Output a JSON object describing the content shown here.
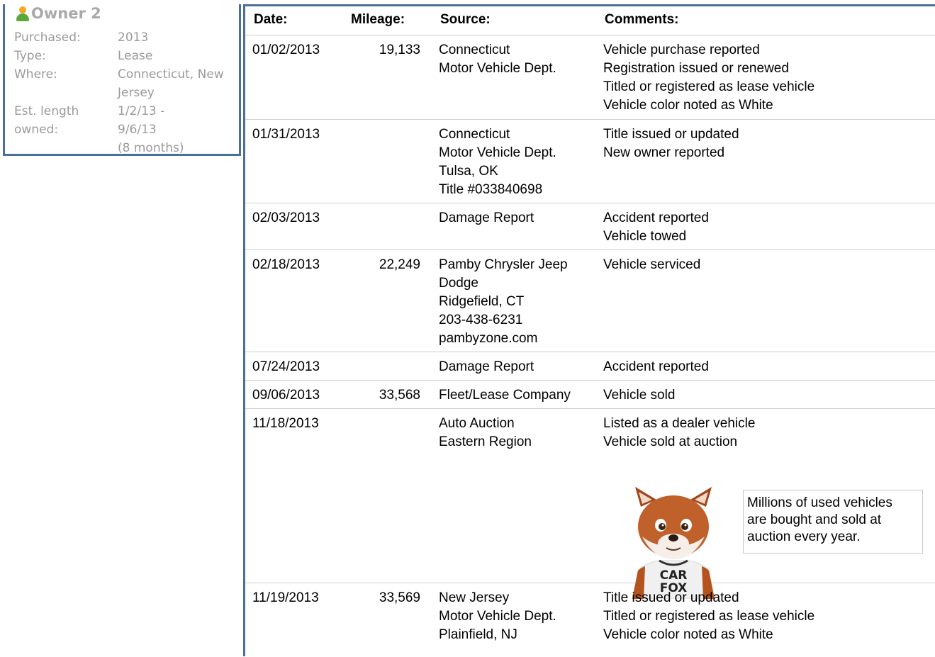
{
  "owner": {
    "title": "Owner 2",
    "fields": [
      {
        "label": "Purchased:",
        "value": [
          "2013"
        ]
      },
      {
        "label": "Type:",
        "value": [
          "Lease"
        ]
      },
      {
        "label": "Where:",
        "value": [
          "Connecticut, New",
          "Jersey"
        ]
      },
      {
        "label": "Est. length",
        "value": [
          "1/2/13 -"
        ]
      },
      {
        "label": "owned:",
        "value": [
          "9/6/13",
          "(8 months)"
        ]
      }
    ]
  },
  "table": {
    "headers": {
      "date": "Date:",
      "mileage": "Mileage:",
      "source": "Source:",
      "comments": "Comments:"
    },
    "rows": [
      {
        "date": "01/02/2013",
        "mileage": "19,133",
        "source": [
          "Connecticut",
          "Motor Vehicle Dept."
        ],
        "comments": [
          "Vehicle purchase reported",
          "Registration issued or renewed",
          "Titled or registered as lease vehicle",
          "Vehicle color noted as White"
        ]
      },
      {
        "date": "01/31/2013",
        "mileage": "",
        "source": [
          "Connecticut",
          "Motor Vehicle Dept.",
          "Tulsa, OK",
          "Title #033840698"
        ],
        "comments": [
          "Title issued or updated",
          "New owner reported"
        ]
      },
      {
        "date": "02/03/2013",
        "mileage": "",
        "source": [
          "Damage Report"
        ],
        "comments": [
          "Accident reported",
          "Vehicle towed"
        ]
      },
      {
        "date": "02/18/2013",
        "mileage": "22,249",
        "source": [
          "Pamby Chrysler Jeep",
          "Dodge",
          "Ridgefield, CT",
          "203-438-6231",
          "pambyzone.com"
        ],
        "comments": [
          "Vehicle serviced"
        ]
      },
      {
        "date": "07/24/2013",
        "mileage": "",
        "source": [
          "Damage Report"
        ],
        "comments": [
          "Accident reported"
        ]
      },
      {
        "date": "09/06/2013",
        "mileage": "33,568",
        "source": [
          "Fleet/Lease Company"
        ],
        "comments": [
          "Vehicle sold"
        ]
      },
      {
        "date": "11/18/2013",
        "mileage": "",
        "source": [
          "Auto Auction",
          "Eastern Region"
        ],
        "comments": [
          "Listed as a dealer vehicle",
          "Vehicle sold at auction"
        ]
      },
      {
        "date": "11/19/2013",
        "mileage": "33,569",
        "source": [
          "New Jersey",
          "Motor Vehicle Dept.",
          "Plainfield, NJ"
        ],
        "comments": [
          "Title issued or updated",
          "Titled or registered as lease vehicle",
          "Vehicle color noted as White"
        ]
      }
    ]
  },
  "fox_callout": {
    "text": [
      "Millions of used vehicles",
      "are bought and sold at",
      "auction every year."
    ],
    "shirt_text": [
      "CAR",
      "FOX"
    ]
  }
}
